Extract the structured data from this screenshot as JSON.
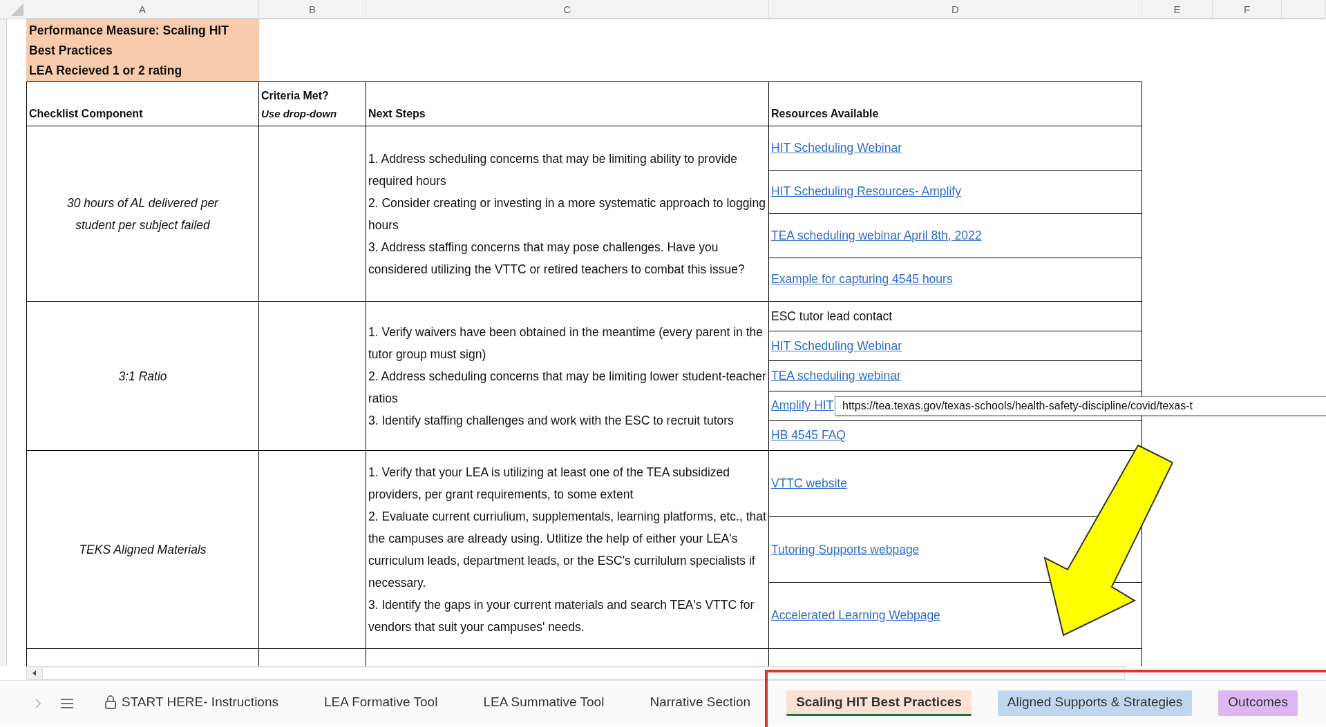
{
  "column_headers": [
    "A",
    "B",
    "C",
    "D",
    "E",
    "F"
  ],
  "title_cell": {
    "lines": [
      "Performance Measure: Scaling HIT Best Practices",
      "LEA Recieved 1 or 2 rating"
    ]
  },
  "table": {
    "columns": [
      {
        "label": "Checklist Component"
      },
      {
        "label": "Criteria Met?",
        "note": "Use drop-down"
      },
      {
        "label": "Next Steps"
      },
      {
        "label": "Resources Available"
      }
    ],
    "rows": [
      {
        "component": "30 hours of AL delivered per student per subject failed",
        "next_steps": [
          "1. Address scheduling concerns that may be limiting ability to provide required hours",
          "2. Consider creating or investing in a more systematic approach to logging hours",
          "3. Address staffing concerns that may pose challenges. Have you considered utilizing the VTTC or retired teachers to combat this issue?"
        ],
        "resources": [
          {
            "kind": "link",
            "text": "HIT Scheduling Webinar"
          },
          {
            "kind": "link",
            "text": "HIT Scheduling Resources- Amplify"
          },
          {
            "kind": "link",
            "text": "TEA scheduling webinar April 8th, 2022"
          },
          {
            "kind": "link",
            "text": "Example for capturing 4545 hours"
          }
        ]
      },
      {
        "component": "3:1 Ratio",
        "next_steps": [
          "1. Verify waivers have been obtained in the meantime (every parent in the tutor group must sign)",
          "2. Address scheduling concerns that may be limiting lower student-teacher ratios",
          "3. Identify staffing challenges and work with the ESC to recruit tutors"
        ],
        "resources": [
          {
            "kind": "text",
            "text": "ESC tutor lead contact"
          },
          {
            "kind": "link",
            "text": "HIT Scheduling Webinar"
          },
          {
            "kind": "link",
            "text": "TEA scheduling webinar"
          },
          {
            "kind": "link",
            "text": "Amplify HIT",
            "tooltip": "https://tea.texas.gov/texas-schools/health-safety-discipline/covid/texas-t"
          },
          {
            "kind": "link",
            "text": "HB 4545 FAQ"
          }
        ]
      },
      {
        "component": "TEKS Aligned Materials",
        "next_steps": [
          "1. Verify that your LEA is utilizing at least one of the TEA subsidized providers, per grant requirements, to some extent",
          "2. Evaluate current curriulium, supplementals, learning platforms, etc., that the campuses are already using. Utlitize the help of either your LEA's curriculum leads, department leads, or the ESC's currilulum specialists if necessary.",
          "3. Identify the gaps in your current materials and search TEA's VTTC for vendors that suit your campuses' needs."
        ],
        "resources": [
          {
            "kind": "link",
            "text": "VTTC website"
          },
          {
            "kind": "link",
            "text": "Tutoring Supports webpage"
          },
          {
            "kind": "link",
            "text": "Accelerated Learning Webpage"
          }
        ]
      }
    ]
  },
  "sheet_tabs": [
    {
      "label": "START HERE- Instructions",
      "locked": true,
      "selected": false
    },
    {
      "label": "LEA Formative Tool",
      "locked": false,
      "selected": false
    },
    {
      "label": "LEA Summative Tool",
      "locked": false,
      "selected": false
    },
    {
      "label": "Narrative Section",
      "locked": false,
      "selected": false
    },
    {
      "label": "Scaling HIT Best Practices",
      "locked": false,
      "selected": true,
      "color": "#fbe2d5"
    },
    {
      "label": "Aligned Supports & Strategies",
      "locked": false,
      "selected": false,
      "color": "#c0d8ef"
    },
    {
      "label": "Outcomes",
      "locked": false,
      "selected": false,
      "color": "#deb6f2"
    }
  ]
}
